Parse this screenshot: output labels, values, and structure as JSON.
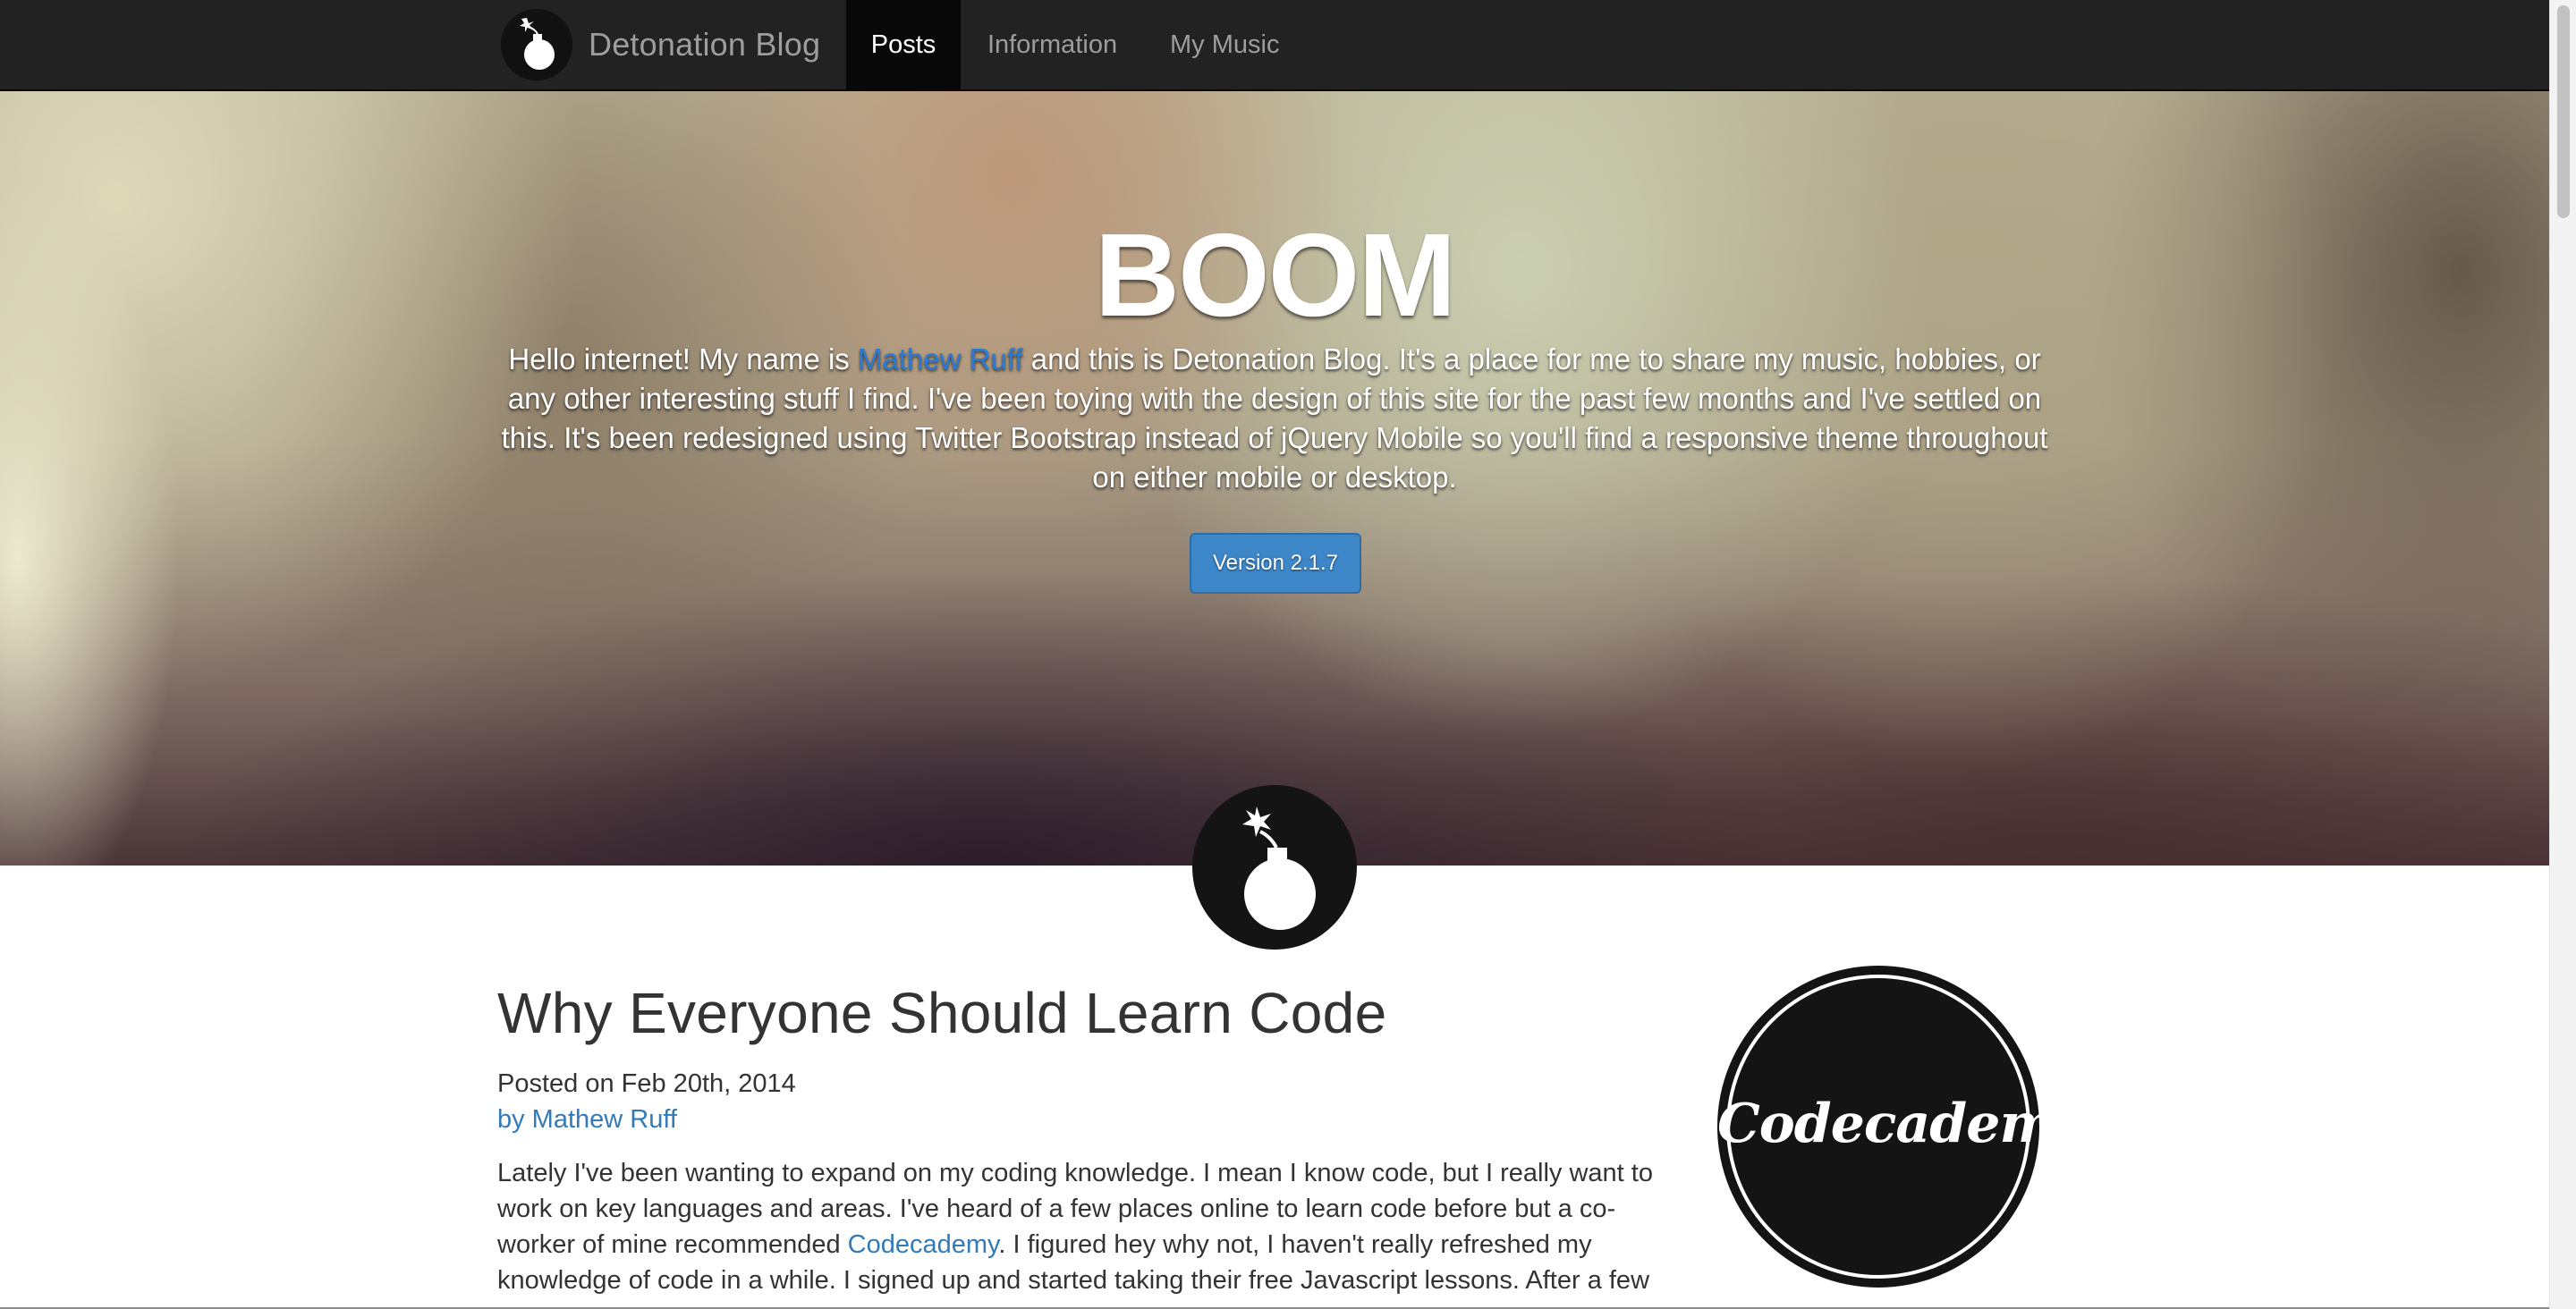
{
  "navbar": {
    "brand": "Detonation Blog",
    "items": [
      {
        "label": "Posts",
        "active": true
      },
      {
        "label": "Information",
        "active": false
      },
      {
        "label": "My Music",
        "active": false
      }
    ]
  },
  "hero": {
    "title": "BOOM",
    "intro_before": "Hello internet! My name is ",
    "author_link": "Mathew Ruff",
    "intro_after": " and this is Detonation Blog. It's a place for me to share my music, hobbies, or any other interesting stuff I find. I've been toying with the design of this site for the past few months and I've settled on this. It's been redesigned using Twitter Bootstrap instead of jQuery Mobile so you'll find a responsive theme throughout on either mobile or desktop.",
    "version_button": "Version 2.1.7"
  },
  "post": {
    "title": "Why Everyone Should Learn Code",
    "date": "Posted on Feb 20th, 2014",
    "author": "by Mathew Ruff",
    "body_before": "Lately I've been wanting to expand on my coding knowledge. I mean I know code, but I really want to work on key languages and areas. I've heard of a few places online to learn code before but a co-worker of mine recommended ",
    "body_link": "Codecademy",
    "body_after": ". I figured hey why not, I haven't really refreshed my knowledge of code in a while. I signed up and started taking their free Javascript lessons. After a few"
  },
  "sidebar": {
    "badge_text": "Codecademy"
  },
  "colors": {
    "navbar_bg": "#222222",
    "link": "#337ab7",
    "button": "#3d86c8"
  },
  "icons": {
    "brand_logo": "bomb-icon",
    "center_logo": "bomb-icon"
  }
}
